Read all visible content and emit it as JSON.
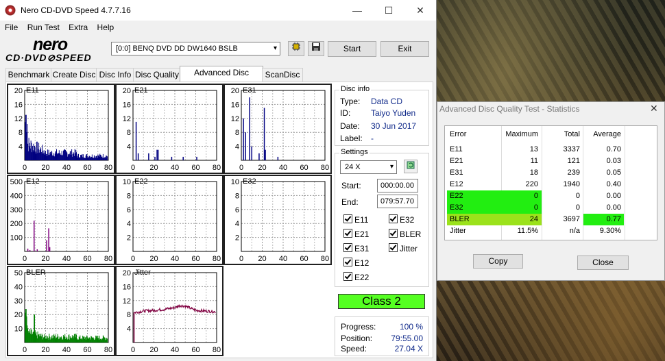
{
  "window": {
    "title": "Nero CD-DVD Speed 4.7.7.16",
    "min": "—",
    "max": "☐",
    "close": "✕"
  },
  "menu": [
    "File",
    "Run Test",
    "Extra",
    "Help"
  ],
  "logo": {
    "line1": "nero",
    "line2": "CD·DVD⊘SPEED"
  },
  "drive": {
    "value": "[0:0]   BENQ DVD DD DW1640 BSLB"
  },
  "toolbar": {
    "start": "Start",
    "exit": "Exit",
    "icon1": "chip-icon",
    "icon2": "save-icon"
  },
  "tabs": [
    "Benchmark",
    "Create Disc",
    "Disc Info",
    "Disc Quality",
    "Advanced Disc Quality",
    "ScanDisc"
  ],
  "active_tab": "Advanced Disc Quality",
  "disc_info": {
    "label": "Disc info",
    "rows": [
      {
        "k": "Type:",
        "v": "Data CD"
      },
      {
        "k": "ID:",
        "v": "Taiyo Yuden"
      },
      {
        "k": "Date:",
        "v": "30 Jun 2017"
      },
      {
        "k": "Label:",
        "v": "-"
      }
    ]
  },
  "settings": {
    "label": "Settings",
    "speed": "24 X",
    "start_label": "Start:",
    "start": "000:00.00",
    "end_label": "End:",
    "end": "079:57.70",
    "checks_left": [
      "E11",
      "E21",
      "E31",
      "E12",
      "E22"
    ],
    "checks_right": [
      "E32",
      "BLER",
      "Jitter"
    ]
  },
  "class": "Class 2",
  "progress": {
    "progress_label": "Progress:",
    "progress": "100 %",
    "position_label": "Position:",
    "position": "79:55.00",
    "speed_label": "Speed:",
    "speed": "27.04 X"
  },
  "chart_data": [
    {
      "type": "bar",
      "title": "E11",
      "xlim": [
        0,
        80
      ],
      "ylim": [
        0,
        20
      ],
      "yticks": [
        4,
        8,
        12,
        16,
        20
      ],
      "xticks": [
        0,
        20,
        40,
        60,
        80
      ],
      "color": "#000080",
      "profile": "dense-decay",
      "peak": 13
    },
    {
      "type": "bar",
      "title": "E21",
      "xlim": [
        0,
        80
      ],
      "ylim": [
        0,
        20
      ],
      "yticks": [
        4,
        8,
        12,
        16,
        20
      ],
      "xticks": [
        0,
        20,
        40,
        60,
        80
      ],
      "color": "#000080",
      "spikes": [
        [
          3,
          11
        ],
        [
          5,
          2
        ],
        [
          15,
          2
        ],
        [
          21,
          1
        ],
        [
          23,
          3
        ],
        [
          24,
          3
        ],
        [
          37,
          1
        ],
        [
          48,
          1
        ],
        [
          61,
          1
        ]
      ]
    },
    {
      "type": "bar",
      "title": "E31",
      "xlim": [
        0,
        80
      ],
      "ylim": [
        0,
        20
      ],
      "yticks": [
        4,
        8,
        12,
        16,
        20
      ],
      "xticks": [
        0,
        20,
        40,
        60,
        80
      ],
      "color": "#000080",
      "spikes": [
        [
          2,
          12
        ],
        [
          4,
          8
        ],
        [
          8,
          18
        ],
        [
          10,
          4
        ],
        [
          17,
          2
        ],
        [
          22,
          15
        ],
        [
          23,
          3
        ],
        [
          35,
          1
        ]
      ]
    },
    {
      "type": "bar",
      "title": "E12",
      "xlim": [
        0,
        80
      ],
      "ylim": [
        0,
        500
      ],
      "yticks": [
        100,
        200,
        300,
        400,
        500
      ],
      "xticks": [
        0,
        20,
        40,
        60,
        80
      ],
      "color": "#800080",
      "spikes": [
        [
          3,
          20
        ],
        [
          5,
          10
        ],
        [
          9,
          220
        ],
        [
          12,
          15
        ],
        [
          21,
          80
        ],
        [
          23,
          165
        ],
        [
          24,
          30
        ]
      ]
    },
    {
      "type": "bar",
      "title": "E22",
      "xlim": [
        0,
        80
      ],
      "ylim": [
        0,
        10
      ],
      "yticks": [
        2,
        4,
        6,
        8,
        10
      ],
      "xticks": [
        0,
        20,
        40,
        60,
        80
      ],
      "color": "#800080",
      "spikes": []
    },
    {
      "type": "bar",
      "title": "E32",
      "xlim": [
        0,
        80
      ],
      "ylim": [
        0,
        10
      ],
      "yticks": [
        2,
        4,
        6,
        8,
        10
      ],
      "xticks": [
        0,
        20,
        40,
        60,
        80
      ],
      "color": "#800080",
      "spikes": []
    },
    {
      "type": "bar",
      "title": "BLER",
      "xlim": [
        0,
        80
      ],
      "ylim": [
        0,
        50
      ],
      "yticks": [
        10,
        20,
        30,
        40,
        50
      ],
      "xticks": [
        0,
        20,
        40,
        60,
        80
      ],
      "color": "#008000",
      "profile": "bler",
      "peak": 24
    },
    {
      "type": "line",
      "title": "Jitter",
      "xlim": [
        0,
        80
      ],
      "ylim": [
        0,
        20
      ],
      "yticks": [
        4,
        8,
        12,
        16,
        20
      ],
      "xticks": [
        0,
        20,
        40,
        60,
        80
      ],
      "color": "#800040",
      "points": [
        [
          2,
          8.6
        ],
        [
          10,
          9.0
        ],
        [
          20,
          9.2
        ],
        [
          30,
          9.5
        ],
        [
          40,
          10.0
        ],
        [
          45,
          10.6
        ],
        [
          50,
          10.4
        ],
        [
          55,
          9.8
        ],
        [
          60,
          9.2
        ],
        [
          70,
          9.0
        ],
        [
          79,
          8.8
        ]
      ]
    }
  ],
  "stats": {
    "title": "Advanced Disc Quality Test - Statistics",
    "close_x": "✕",
    "headers": [
      "Error",
      "Maximum",
      "Total",
      "Average"
    ],
    "rows": [
      {
        "e": "E11",
        "max": "13",
        "total": "3337",
        "avg": "0.70"
      },
      {
        "e": "E21",
        "max": "11",
        "total": "121",
        "avg": "0.03"
      },
      {
        "e": "E31",
        "max": "18",
        "total": "239",
        "avg": "0.05"
      },
      {
        "e": "E12",
        "max": "220",
        "total": "1940",
        "avg": "0.40"
      },
      {
        "e": "E22",
        "max": "0",
        "total": "0",
        "avg": "0.00"
      },
      {
        "e": "E32",
        "max": "0",
        "total": "0",
        "avg": "0.00"
      },
      {
        "e": "BLER",
        "max": "24",
        "total": "3697",
        "avg": "0.77"
      },
      {
        "e": "Jitter",
        "max": "11.5%",
        "total": "n/a",
        "avg": "9.30%"
      }
    ],
    "copy": "Copy",
    "close": "Close",
    "highlight_green": "#22ee11",
    "highlight_yellow": "#9be21b"
  }
}
